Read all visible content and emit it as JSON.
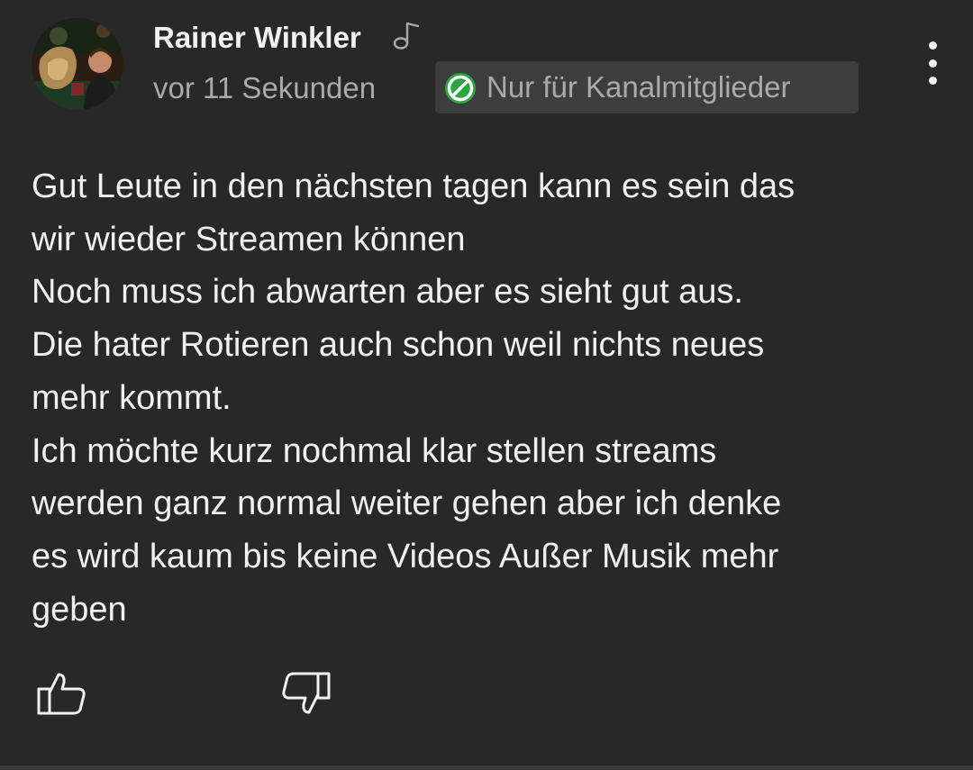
{
  "comment": {
    "author_name": "Rainer Winkler",
    "author_badge_icon": "music-note-icon",
    "timestamp": "vor 11 Sekunden",
    "visibility_badge": {
      "label": "Nur für Kanalmitglieder",
      "icon": "members-only-icon",
      "icon_color": "#2ba640"
    },
    "menu_icon": "more-vertical-icon",
    "body_lines": [
      "Gut Leute in den nächsten tagen kann es sein das",
      "wir wieder Streamen können",
      "Noch muss ich abwarten aber es sieht gut aus.",
      "Die hater Rotieren auch schon weil nichts neues",
      "mehr kommt.",
      "Ich möchte kurz nochmal klar stellen streams",
      "werden ganz normal weiter gehen aber ich denke",
      "es wird kaum bis keine Videos Außer Musik mehr",
      "geben"
    ],
    "actions": {
      "like_icon": "thumbs-up-icon",
      "dislike_icon": "thumbs-down-icon"
    }
  },
  "colors": {
    "background": "#282828",
    "text_primary": "#f1f1f1",
    "text_secondary": "#aaaaaa",
    "badge_background": "#3d3d3d",
    "members_green": "#2ba640"
  }
}
